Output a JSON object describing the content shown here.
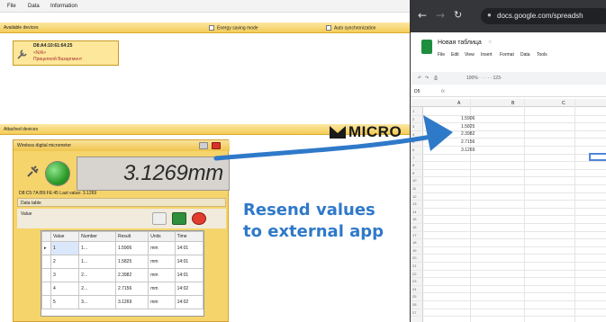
{
  "menu": {
    "file": "File",
    "data": "Data",
    "information": "Information"
  },
  "available": {
    "title": "Available devices",
    "energy": "Energy saving mode",
    "autosync": "Auto synchronization",
    "device": {
      "mac": "D8:A4:10:61:64:25",
      "line2": "<N/A>",
      "line3": "Прицепной Вазаргмент"
    }
  },
  "attached": {
    "title": "Attached devices"
  },
  "brand": {
    "name": "MICRO"
  },
  "panel": {
    "title": "Wireless digital micrometer",
    "reading": "3.1269mm",
    "info": "D8:C5:7A:B9:FE:45  Last value: 3.1269",
    "datatable_title": "Data table",
    "value_label": "Value",
    "table": {
      "headers": [
        "Value",
        "Number",
        "Result",
        "Units",
        "Time"
      ],
      "rows": [
        [
          "1",
          "1...",
          "1.5906",
          "mm",
          "14:01"
        ],
        [
          "2",
          "1...",
          "1.5825",
          "mm",
          "14:01"
        ],
        [
          "3",
          "2...",
          "2.3982",
          "mm",
          "14:01"
        ],
        [
          "4",
          "2...",
          "2.7156",
          "mm",
          "14:02"
        ],
        [
          "5",
          "3...",
          "3.1269",
          "mm",
          "14:02"
        ]
      ]
    }
  },
  "annotation": {
    "line1": "Resend values",
    "line2": "to external app"
  },
  "browser": {
    "url": "docs.google.com/spreadsh",
    "doc_title": "Новая таблица",
    "menu": [
      "File",
      "Edit",
      "View",
      "Insert",
      "Format",
      "Data",
      "Tools"
    ],
    "toolbar": "100%  ·  ·  ·  ·  ·  123·",
    "namebox": "D5",
    "columns": [
      "A",
      "B",
      "C"
    ],
    "values": [
      "1.5906",
      "1.5825",
      "2.3982",
      "2.7156",
      "3.1269"
    ],
    "row_numbers": [
      "1",
      "2",
      "3",
      "4",
      "5",
      "6",
      "7",
      "8",
      "9",
      "10",
      "11",
      "12",
      "13",
      "14",
      "15",
      "16",
      "17",
      "18",
      "19",
      "20",
      "21",
      "22",
      "23",
      "24",
      "25",
      "26",
      "27"
    ]
  },
  "colors": {
    "accent_yellow": "#f4cc57",
    "annotation_blue": "#2f79c9",
    "chrome_dark": "#35363a",
    "sheets_green": "#1e8e3e"
  }
}
